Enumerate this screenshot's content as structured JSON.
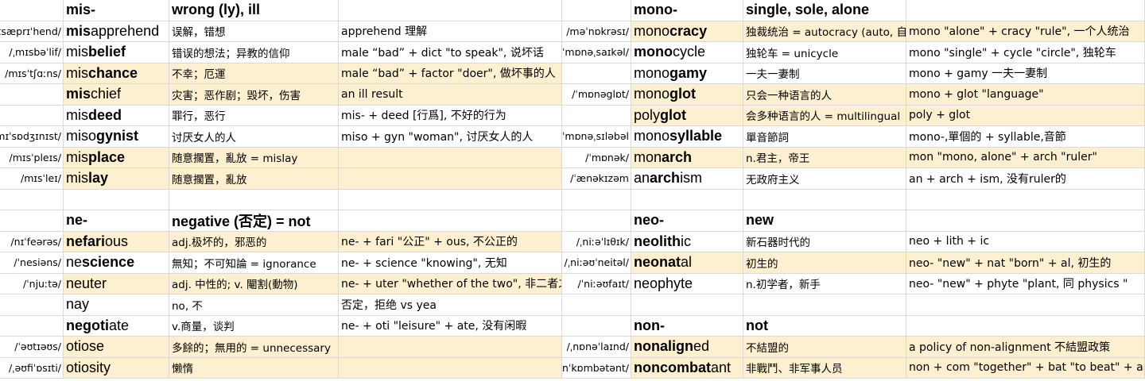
{
  "left": {
    "rows": [
      {
        "ipa": "",
        "prefix": "mis-",
        "rest": "",
        "def": "wrong (ly), ill",
        "ety": "",
        "hdr": true,
        "hl": false
      },
      {
        "ipa": "/ˌmɪsæprɪˈhend/",
        "prefix": "mis",
        "rest": "apprehend",
        "bold": "",
        "def": "误解，错想",
        "ety": "apprehend 理解",
        "hl": false
      },
      {
        "ipa": "/ˌmɪsbəˈlif/",
        "prefix": "mis",
        "rest": "",
        "bold": "belief",
        "def": "错误的想法；异教的信仰",
        "ety": "male “bad” + dict \"to speak\", 说坏话",
        "hl": false
      },
      {
        "ipa": "/mɪsˈtʃɑːns/",
        "prefix": "mis",
        "rest": "",
        "bold": "chance",
        "def": "不幸；厄運",
        "ety": "male “bad” + factor \"doer\", 做坏事的人",
        "hl": true
      },
      {
        "ipa": "",
        "prefix": "mis",
        "rest": "chief",
        "bold": "",
        "def": "灾害；恶作剧；毁坏，伤害",
        "ety": "an ill result",
        "hl": true
      },
      {
        "ipa": "",
        "prefix": "mis",
        "rest": "",
        "bold": "deed",
        "def": "罪行，恶行",
        "ety": "mis-  + deed [行爲], 不好的行为",
        "hl": false
      },
      {
        "ipa": "/mɪˈsɒdʒɪnɪst/",
        "prefix": "miso",
        "rest": "",
        "bold": "gynist",
        "def": "讨厌女人的人",
        "ety": "miso + gyn \"woman\", 讨厌女人的人",
        "hl": false
      },
      {
        "ipa": "/mɪsˈpleɪs/",
        "prefix": "mis",
        "rest": "",
        "bold": "place",
        "def": "随意擱置，亂放 = mislay",
        "ety": "",
        "hl": true
      },
      {
        "ipa": "/mɪsˈleɪ/",
        "prefix": "mis",
        "rest": "",
        "bold": "lay",
        "def": "随意擱置，亂放",
        "ety": "",
        "hl": true
      },
      {
        "ipa": "",
        "prefix": "",
        "rest": "",
        "bold": "",
        "def": "",
        "ety": "",
        "hl": false
      },
      {
        "ipa": "",
        "prefix": "ne-",
        "rest": "",
        "def": "negative (否定) = not",
        "ety": "",
        "hdr": true,
        "hl": false
      },
      {
        "ipa": "/nɪˈfeərəs/",
        "prefix": "nefari",
        "rest": "ous",
        "bold": "",
        "def": "adj.极坏的，邪恶的",
        "ety": "ne- + fari \"公正\" + ous, 不公正的",
        "hl": true
      },
      {
        "ipa": "/ˈnesiəns/",
        "prefix": "ne",
        "rest": "",
        "bold": "science",
        "def": " 無知；不可知論 = ignorance",
        "ety": "ne- + science \"knowing\", 无知",
        "hl": false
      },
      {
        "ipa": "/ˈnjuːtə/",
        "prefix": "neuter",
        "rest": "",
        "bold": "",
        "def": "adj. 中性的; v. 閹割(動物)",
        "ety": "ne- + uter \"whether of the two\", 非二者之一",
        "hl": true
      },
      {
        "ipa": "",
        "prefix": "",
        "rest": "nay",
        "bold": "",
        "def": "no, 不",
        "ety": "否定，拒绝 vs yea",
        "hl": false
      },
      {
        "ipa": "",
        "prefix": "",
        "rest": "negoti",
        "bold": "",
        "tail": "ate",
        "def": "v.商量，谈判",
        "ety": "ne- + oti \"leisure\" + ate, 没有闲暇",
        "hl": false
      },
      {
        "ipa": "/ˈəʊtɪəʊs/",
        "prefix": "otiose",
        "rest": "",
        "bold": "",
        "def": "多餘的；無用的 =  unnecessary",
        "ety": "",
        "hl": true
      },
      {
        "ipa": "/ˌəʊfiˈɒsɪti/",
        "prefix": "otiosity",
        "rest": "",
        "bold": "",
        "def": "懒惰",
        "ety": "",
        "hl": true
      }
    ]
  },
  "right": {
    "rows": [
      {
        "ipa": "",
        "prefix": "mono-",
        "rest": "",
        "def": "single, sole, alone",
        "ety": "",
        "hdr": true,
        "hl": false
      },
      {
        "ipa": "/məˈnɒkrəsɪ/",
        "prefix": "mono",
        "rest": "",
        "bold": "cracy",
        "def": "独裁统治 = autocracy (auto, 自己的)",
        "ety": "mono \"alone\" + cracy \"rule\", 一个人统治",
        "hl": true
      },
      {
        "ipa": "/ˈmɒnəˌsaɪkəl/",
        "prefix": "mono",
        "rest": "cycle",
        "bold": "",
        "def": "独轮车 = unicycle",
        "ety": "mono \"single\" + cycle \"circle\", 独轮车",
        "hl": false
      },
      {
        "ipa": "",
        "prefix": "mono",
        "rest": "",
        "bold": "gamy",
        "def": "一夫一妻制",
        "ety": "mono + gamy 一夫一妻制",
        "hl": false
      },
      {
        "ipa": "/ˈmɒnəglɒt/",
        "prefix": "mono",
        "rest": "",
        "bold": "glot",
        "def": "只会一种语言的人",
        "ety": "mono + glot \"language\"",
        "hl": true
      },
      {
        "ipa": "",
        "prefix": "poly",
        "rest": "",
        "bold": "glot",
        "def": "会多种语言的人 = multilingual",
        "ety": "poly + glot",
        "hl": true
      },
      {
        "ipa": "/ˈmɒnəˌsɪləbəl",
        "prefix": "mono",
        "rest": "",
        "bold": "syllable",
        "def": "單音節詞",
        "ety": "mono-,單個的 + syllable,音節",
        "hl": false
      },
      {
        "ipa": "/ˈmɒnək/",
        "prefix": "mon",
        "rest": "",
        "bold": "arch",
        "def": "n.君主，帝王",
        "ety": "mon \"mono, alone\" + arch \"ruler\"",
        "hl": true
      },
      {
        "ipa": "/ˈænəkɪzəm",
        "prefix": "an",
        "rest": "",
        "bold": "arch",
        "tail": "ism",
        "def": "无政府主义",
        "ety": "an + arch + ism, 没有ruler的",
        "hl": false
      },
      {
        "ipa": "",
        "prefix": "",
        "rest": "",
        "bold": "",
        "def": "",
        "ety": "",
        "hl": false
      },
      {
        "ipa": "",
        "prefix": "neo-",
        "rest": "",
        "def": "new",
        "ety": "",
        "hdr": true,
        "hl": false
      },
      {
        "ipa": "/ˌniːəˈlɪθɪk/",
        "prefix": "neolith",
        "rest": "ic",
        "bold": "",
        "def": "新石器时代的",
        "ety": "neo + lith + ic",
        "hl": false
      },
      {
        "ipa": "/ˌniːəʊˈneitəl/",
        "prefix": "neonat",
        "rest": "al",
        "bold": "",
        "def": "初生的",
        "ety": "neo- \"new\" + nat \"born\" + al, 初生的",
        "hl": true
      },
      {
        "ipa": "/ˈniːəʊfaɪt/",
        "prefix": "neophyte",
        "rest": "",
        "bold": "",
        "def": "n.初学者，新手",
        "ety": "neo- \"new\" + phyte \"plant, 同 physics \"",
        "hl": false
      },
      {
        "ipa": "",
        "prefix": "",
        "rest": "",
        "bold": "",
        "def": "",
        "ety": "",
        "hl": false
      },
      {
        "ipa": "",
        "prefix": "non-",
        "rest": "",
        "def": "not",
        "ety": "",
        "hdr": true,
        "hl": false
      },
      {
        "ipa": "/ˌnɒnəˈlaɪnd/",
        "prefix": "nonalign",
        "rest": "ed",
        "bold": "",
        "def": "不結盟的",
        "ety": "a policy of non-alignment  不結盟政策",
        "hl": true
      },
      {
        "ipa": "/ˌnɒnˈkɒmbətənt/",
        "prefix": "noncombat",
        "rest": "ant",
        "bold": "",
        "def": "非戰鬥、非军事人员",
        "ety": "non + com \"together\" + bat \"to beat\" + ant",
        "hl": true
      }
    ]
  }
}
